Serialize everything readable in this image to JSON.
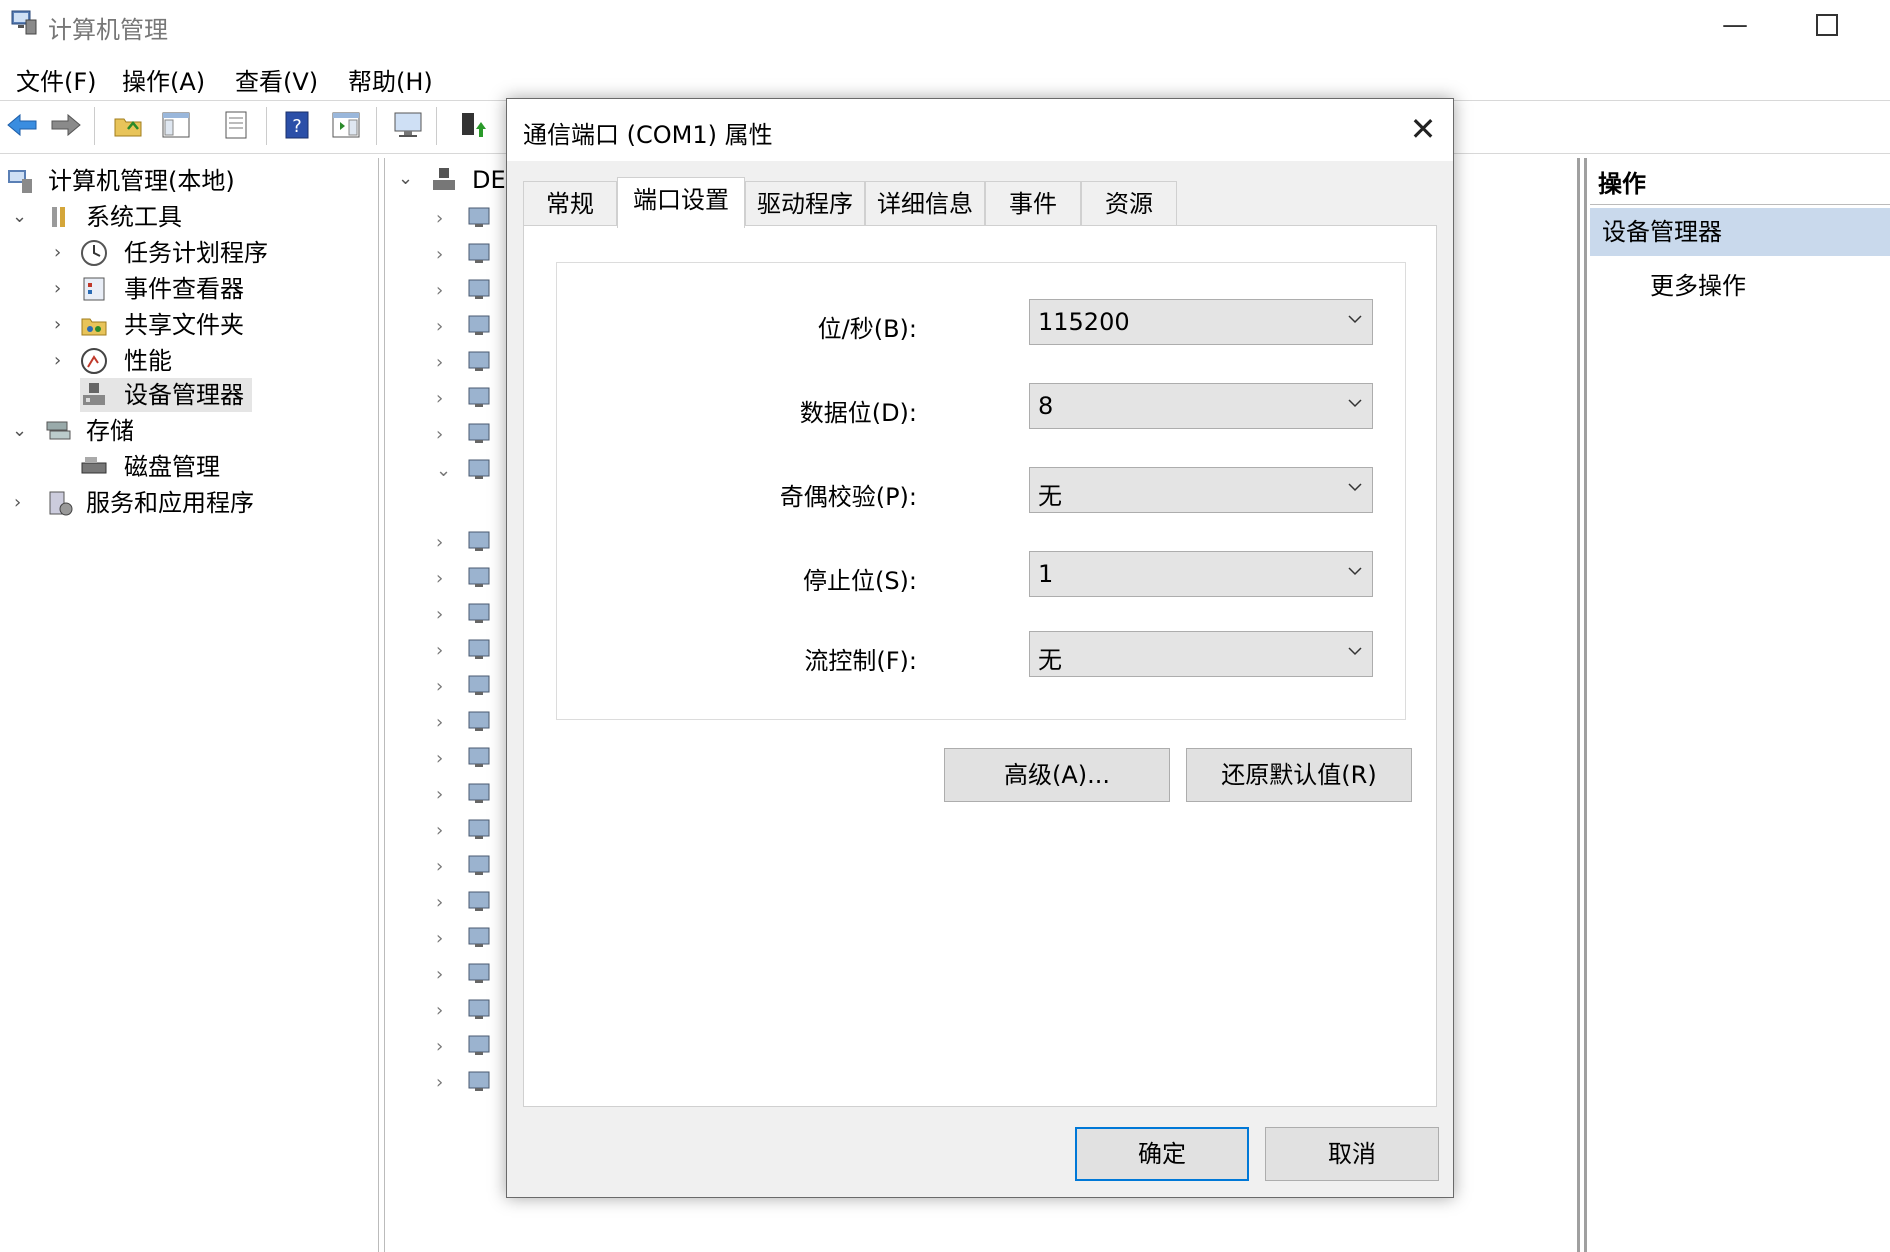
{
  "app": {
    "title": "计算机管理"
  },
  "menu": [
    "文件(F)",
    "操作(A)",
    "查看(V)",
    "帮助(H)"
  ],
  "toolbar_icons": [
    "back-arrow-icon",
    "forward-arrow-icon",
    "up-folder-icon",
    "show-hide-tree-icon",
    "properties-icon",
    "help-icon",
    "show-hide-action-pane-icon",
    "computer-monitor-icon",
    "update-driver-icon"
  ],
  "tree": {
    "root": "计算机管理(本地)",
    "system_tools": "系统工具",
    "task_scheduler": "任务计划程序",
    "event_viewer": "事件查看器",
    "shared_folders": "共享文件夹",
    "performance": "性能",
    "device_manager": "设备管理器",
    "storage": "存储",
    "disk_management": "磁盘管理",
    "services_apps": "服务和应用程序"
  },
  "device_tree": {
    "root_label": "DES"
  },
  "actions": {
    "header": "操作",
    "section": "设备管理器",
    "more": "更多操作"
  },
  "dialog": {
    "title": "通信端口 (COM1) 属性",
    "close": "✕",
    "tabs": [
      "常规",
      "端口设置",
      "驱动程序",
      "详细信息",
      "事件",
      "资源"
    ],
    "active_tab": "端口设置",
    "fields": {
      "baud_label": "位/秒(B):",
      "baud_value": "115200",
      "data_bits_label": "数据位(D):",
      "data_bits_value": "8",
      "parity_label": "奇偶校验(P):",
      "parity_value": "无",
      "stop_bits_label": "停止位(S):",
      "stop_bits_value": "1",
      "flow_label": "流控制(F):",
      "flow_value": "无"
    },
    "advanced_button": "高级(A)...",
    "restore_button": "还原默认值(R)",
    "ok_button": "确定",
    "cancel_button": "取消"
  },
  "colors": {
    "accent": "#0078d7",
    "selection": "#c9d9ec"
  }
}
